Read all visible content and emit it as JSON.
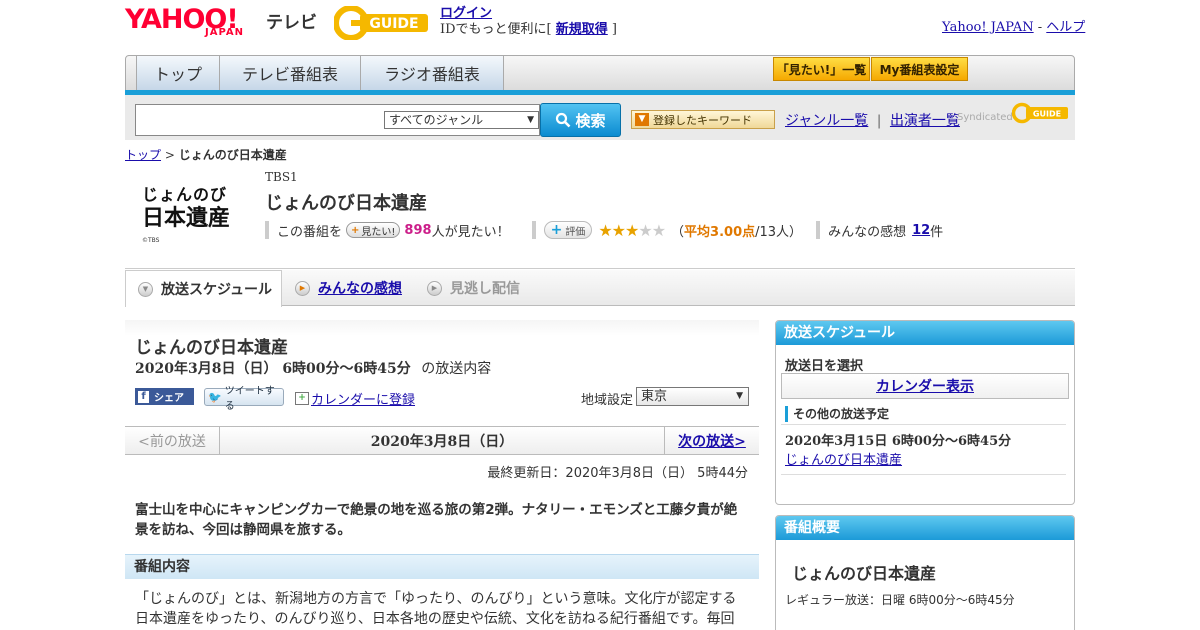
{
  "header": {
    "yahoo_logo": "YAHOO!",
    "japan_logo": "JAPAN",
    "tv_label": "テレビ",
    "gguide_logo": "G-GUIDE",
    "login": "ログイン",
    "login_desc_prefix": "IDでもっと便利に[ ",
    "signup": "新規取得",
    "login_desc_suffix": " ]",
    "yahoo_japan_link": "Yahoo! JAPAN",
    "sep": " - ",
    "help_link": "ヘルプ"
  },
  "nav": {
    "tabs": [
      "トップ",
      "テレビ番組表",
      "ラジオ番組表"
    ],
    "mitai_list": "「見たい!」一覧",
    "my_schedule": "My番組表設定"
  },
  "search": {
    "placeholder": "",
    "genre_selected": "すべてのジャンル",
    "button": "検索",
    "keyword_button": "登録したキーワード",
    "genre_list": "ジャンル一覧",
    "cast_list": "出演者一覧",
    "separator": "|",
    "syndicated": "Syndicated"
  },
  "breadcrumb": {
    "top": "トップ",
    "sep": " > ",
    "current": "じょんのび日本遺産"
  },
  "program": {
    "logo_text": "じょんのび日本遺産",
    "logo_copyright": "©TBS",
    "channel": "TBS1",
    "title": "じょんのび日本遺産",
    "mitai_prefix": "この番組を",
    "mitai_button": "見たい!",
    "mitai_count": "898",
    "mitai_suffix": "人が見たい！",
    "rate_button": "評価",
    "rating_value": 3.0,
    "rating_max": 5,
    "avg_open": "（",
    "avg_text": "平均3.00点",
    "avg_count": "/13人）",
    "impressions_label": "みんなの感想",
    "impressions_count": "12",
    "impressions_unit": "件"
  },
  "tabs": {
    "schedule": "放送スケジュール",
    "impressions": "みんなの感想",
    "vod": "見逃し配信"
  },
  "main": {
    "title": "じょんのび日本遺産",
    "date_bold": "2020年3月8日（日） 6時00分～6時45分",
    "date_suffix": "の放送内容",
    "share_fb": "シェア",
    "tweet": "ツイートする",
    "calendar_register": "カレンダーに登録",
    "region_label": "地域設定",
    "region_selected": "東京",
    "prev": "<前の放送",
    "current_date": "2020年3月8日（日）",
    "next": "次の放送>",
    "updated": "最終更新日：2020年3月8日（日） 5時44分",
    "summary": "富士山を中心にキャンピングカーで絶景の地を巡る旅の第2弾。ナタリー・エモンズと工藤夕貴が絶景を訪ね、今回は静岡県を旅する。",
    "section_title": "番組内容",
    "body": "「じょんのび」とは、新潟地方の方言で「ゆったり、のんびり」という意味。文化庁が認定する日本遺産をゆったり、のんびり巡り、日本各地の歴史や伝統、文化を訪ねる紀行番組です。毎回"
  },
  "sidebar": {
    "schedule_head": "放送スケジュール",
    "select_date": "放送日を選択",
    "calendar_show": "カレンダー表示",
    "other_head": "その他の放送予定",
    "other_time": "2020年3月15日 6時00分～6時45分",
    "other_title": "じょんのび日本遺産",
    "overview_head": "番組概要",
    "overview_title": "じょんのび日本遺産",
    "regular": "レギュラー放送：日曜 6時00分～6時45分"
  },
  "colors": {
    "accent_blue": "#1a9fd8",
    "yahoo_red": "#ff0033",
    "star": "#e8a200",
    "pink": "#cc1f8a",
    "orange": "#e07800"
  }
}
